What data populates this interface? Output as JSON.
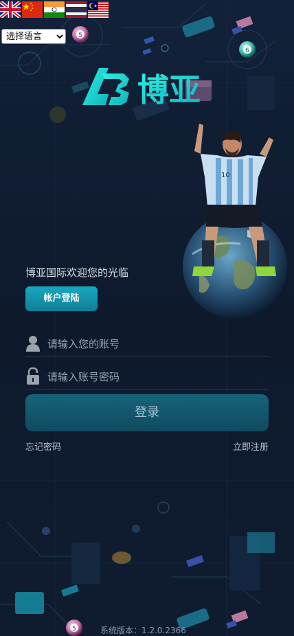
{
  "languages": {
    "flags": [
      "uk-flag-icon",
      "china-flag-icon",
      "india-flag-icon",
      "thailand-flag-icon",
      "malaysia-flag-icon"
    ],
    "select_value": "选择语言"
  },
  "brand": {
    "logo_text": "博亚",
    "accent_color": "#1ad6d0",
    "jersey_number": "10"
  },
  "decor": {
    "ball_number_top": "5",
    "ball_number_right": "6",
    "ball_number_bottom": "5"
  },
  "login": {
    "welcome": "博亚国际欢迎您的光临",
    "tab_account": "帐户登陆",
    "account_placeholder": "请输入您的账号",
    "password_placeholder": "请输入账号密码",
    "login_button": "登录",
    "forgot_password": "忘记密码",
    "register": "立即注册"
  },
  "footer": {
    "version": "系统版本：1.2.0.2366"
  }
}
